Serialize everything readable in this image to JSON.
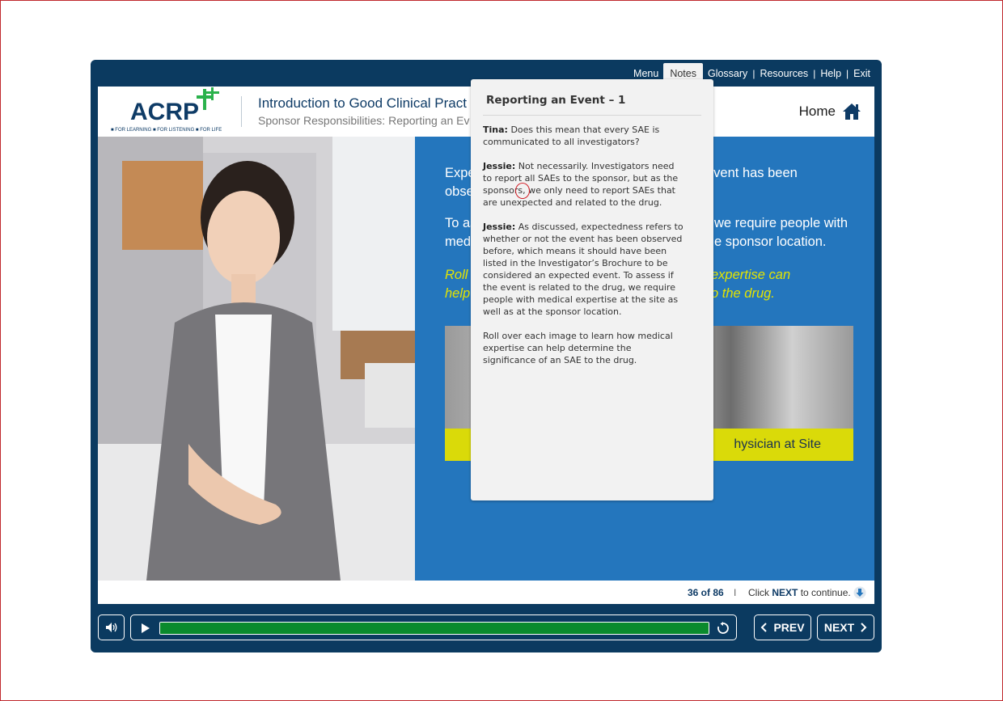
{
  "nav": {
    "items": [
      "Menu",
      "Notes",
      "Glossary",
      "Resources",
      "Help",
      "Exit"
    ],
    "active": "Notes"
  },
  "header": {
    "logo_text": "ACRP",
    "logo_tagline": "■ FOR LEARNING ■ FOR LISTENING ■ FOR LIFE",
    "course_title": "Introduction to Good Clinical Pract",
    "course_subtitle": "Sponsor Responsibilities: Reporting an Ev",
    "home_label": "Home"
  },
  "slide": {
    "para1_a": "Expe",
    "para1_b": "obse",
    "para1_right_a": "event has been",
    "para2_a": "To as",
    "para2_b": "med",
    "para2_right_a": "we require people with",
    "para2_right_b": "e sponsor location.",
    "para3_a": "Roll",
    "para3_b": "help",
    "para3_right_a": "expertise can",
    "para3_right_b": "o the drug.",
    "caption_right": "hysician at Site"
  },
  "notes": {
    "title": "Reporting an Event – 1",
    "p1_speaker": "Tina:",
    "p1_text": "Does this mean that every SAE is communicated to all investigators?",
    "p2_speaker": "Jessie:",
    "p2_text": "Not necessarily. Investigators need to report all SAEs to the sponsor, but as the sponsors, we only need to report SAEs that are unexpected and related to the drug.",
    "p3_speaker": "Jessie:",
    "p3_text": "As discussed, expectedness refers to whether or not the event has been observed before, which means it should have been listed in the Investigator’s Brochure to be considered an expected event. To assess if the event is related to the drug, we require people with medical expertise at the site as well as at the sponsor location.",
    "p4_text": "Roll over each image to learn how medical expertise can help determine the significance of an SAE to the drug."
  },
  "footer": {
    "page_counter": "36 of 86",
    "separator": "I",
    "continue_prefix": "Click ",
    "continue_bold": "NEXT",
    "continue_suffix": " to continue."
  },
  "controls": {
    "prev_label": "PREV",
    "next_label": "NEXT",
    "progress": 1.0
  },
  "colors": {
    "frame": "#0b3a60",
    "slide_blue": "#2476bd",
    "accent_yellow": "#dada09",
    "progress_green": "#0a8a2d",
    "logo_green": "#2bb24c"
  },
  "icons": [
    "home-icon",
    "volume-icon",
    "play-icon",
    "replay-icon",
    "chevron-left-icon",
    "chevron-right-icon",
    "down-arrow-icon"
  ]
}
